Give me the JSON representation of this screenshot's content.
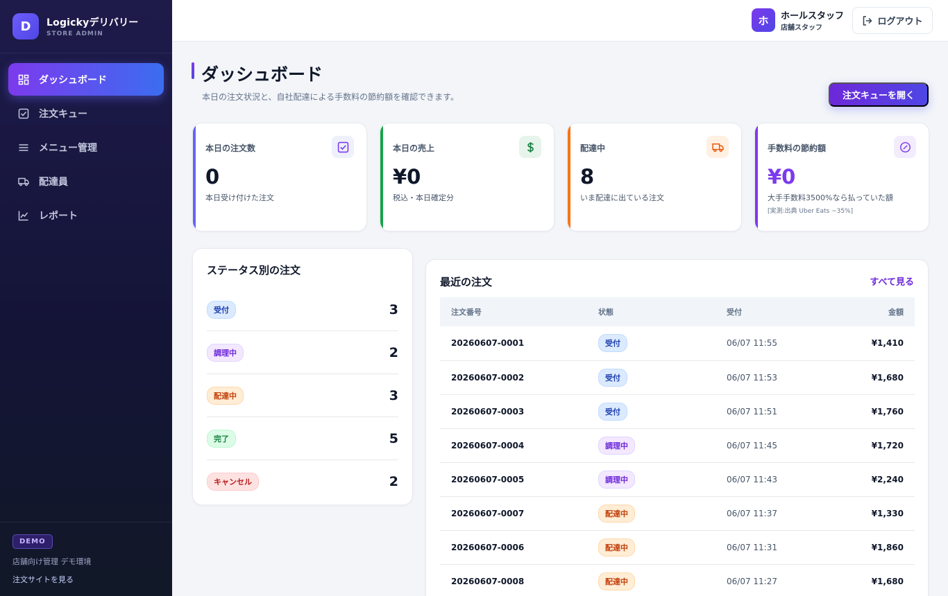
{
  "brand": {
    "logo_letter": "D",
    "name": "Logickyデリバリー",
    "sub": "STORE ADMIN"
  },
  "nav": [
    {
      "label": "ダッシュボード",
      "icon": "dashboard-icon",
      "active": true
    },
    {
      "label": "注文キュー",
      "icon": "checkbox-icon",
      "active": false
    },
    {
      "label": "メニュー管理",
      "icon": "menu-lines-icon",
      "active": false
    },
    {
      "label": "配達員",
      "icon": "truck-icon",
      "active": false
    },
    {
      "label": "レポート",
      "icon": "chart-icon",
      "active": false
    }
  ],
  "sidebar_footer": {
    "badge": "DEMO",
    "text": "店舗向け管理 デモ環境",
    "link": "注文サイトを見る"
  },
  "topbar": {
    "avatar_letter": "ホ",
    "user_name": "ホールスタッフ",
    "user_role": "店舗スタッフ",
    "logout_label": "ログアウト"
  },
  "header": {
    "title": "ダッシュボード",
    "subtitle": "本日の注文状況と、自社配達による手数料の節約額を確認できます。",
    "queue_button": "注文キューを開く"
  },
  "stats": [
    {
      "label": "本日の注文数",
      "value": "0",
      "desc": "本日受け付けた注文",
      "note": "",
      "color": "#6366f1",
      "icon": "checkbox-icon"
    },
    {
      "label": "本日の売上",
      "value": "¥0",
      "desc": "税込・本日確定分",
      "note": "",
      "color": "#16a34a",
      "icon": "dollar-icon"
    },
    {
      "label": "配達中",
      "value": "8",
      "desc": "いま配達に出ている注文",
      "note": "",
      "color": "#f97316",
      "icon": "truck-icon"
    },
    {
      "label": "手数料の節約額",
      "value": "¥0",
      "desc": "大手手数料3500%なら払っていた額",
      "note": "[実測:出典 Uber Eats ~35%]",
      "color": "#7c3aed",
      "icon": "badge-percent-icon"
    }
  ],
  "status_panel": {
    "title": "ステータス別の注文",
    "rows": [
      {
        "label": "受付",
        "count": "3",
        "kind": "accepted"
      },
      {
        "label": "調理中",
        "count": "2",
        "kind": "cooking"
      },
      {
        "label": "配達中",
        "count": "3",
        "kind": "delivering"
      },
      {
        "label": "完了",
        "count": "5",
        "kind": "done"
      },
      {
        "label": "キャンセル",
        "count": "2",
        "kind": "cancel"
      }
    ]
  },
  "orders": {
    "title": "最近の注文",
    "see_all": "すべて見る",
    "columns": [
      "注文番号",
      "状態",
      "受付",
      "金額"
    ],
    "rows": [
      {
        "id": "20260607-0001",
        "status": "受付",
        "kind": "accepted",
        "time": "06/07 11:55",
        "amount": "¥1,410"
      },
      {
        "id": "20260607-0002",
        "status": "受付",
        "kind": "accepted",
        "time": "06/07 11:53",
        "amount": "¥1,680"
      },
      {
        "id": "20260607-0003",
        "status": "受付",
        "kind": "accepted",
        "time": "06/07 11:51",
        "amount": "¥1,760"
      },
      {
        "id": "20260607-0004",
        "status": "調理中",
        "kind": "cooking",
        "time": "06/07 11:45",
        "amount": "¥1,720"
      },
      {
        "id": "20260607-0005",
        "status": "調理中",
        "kind": "cooking",
        "time": "06/07 11:43",
        "amount": "¥2,240"
      },
      {
        "id": "20260607-0007",
        "status": "配達中",
        "kind": "delivering",
        "time": "06/07 11:37",
        "amount": "¥1,330"
      },
      {
        "id": "20260607-0006",
        "status": "配達中",
        "kind": "delivering",
        "time": "06/07 11:31",
        "amount": "¥1,860"
      },
      {
        "id": "20260607-0008",
        "status": "配達中",
        "kind": "delivering",
        "time": "06/07 11:27",
        "amount": "¥1,680"
      }
    ]
  }
}
